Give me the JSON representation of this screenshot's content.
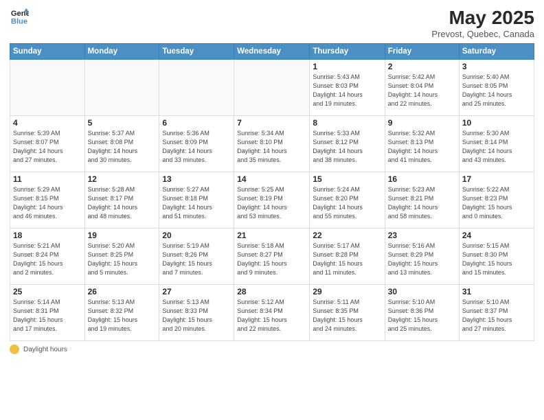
{
  "logo": {
    "line1": "General",
    "line2": "Blue"
  },
  "title": "May 2025",
  "subtitle": "Prevost, Quebec, Canada",
  "days_header": [
    "Sunday",
    "Monday",
    "Tuesday",
    "Wednesday",
    "Thursday",
    "Friday",
    "Saturday"
  ],
  "weeks": [
    [
      {
        "num": "",
        "info": ""
      },
      {
        "num": "",
        "info": ""
      },
      {
        "num": "",
        "info": ""
      },
      {
        "num": "",
        "info": ""
      },
      {
        "num": "1",
        "info": "Sunrise: 5:43 AM\nSunset: 8:03 PM\nDaylight: 14 hours\nand 19 minutes."
      },
      {
        "num": "2",
        "info": "Sunrise: 5:42 AM\nSunset: 8:04 PM\nDaylight: 14 hours\nand 22 minutes."
      },
      {
        "num": "3",
        "info": "Sunrise: 5:40 AM\nSunset: 8:05 PM\nDaylight: 14 hours\nand 25 minutes."
      }
    ],
    [
      {
        "num": "4",
        "info": "Sunrise: 5:39 AM\nSunset: 8:07 PM\nDaylight: 14 hours\nand 27 minutes."
      },
      {
        "num": "5",
        "info": "Sunrise: 5:37 AM\nSunset: 8:08 PM\nDaylight: 14 hours\nand 30 minutes."
      },
      {
        "num": "6",
        "info": "Sunrise: 5:36 AM\nSunset: 8:09 PM\nDaylight: 14 hours\nand 33 minutes."
      },
      {
        "num": "7",
        "info": "Sunrise: 5:34 AM\nSunset: 8:10 PM\nDaylight: 14 hours\nand 35 minutes."
      },
      {
        "num": "8",
        "info": "Sunrise: 5:33 AM\nSunset: 8:12 PM\nDaylight: 14 hours\nand 38 minutes."
      },
      {
        "num": "9",
        "info": "Sunrise: 5:32 AM\nSunset: 8:13 PM\nDaylight: 14 hours\nand 41 minutes."
      },
      {
        "num": "10",
        "info": "Sunrise: 5:30 AM\nSunset: 8:14 PM\nDaylight: 14 hours\nand 43 minutes."
      }
    ],
    [
      {
        "num": "11",
        "info": "Sunrise: 5:29 AM\nSunset: 8:15 PM\nDaylight: 14 hours\nand 46 minutes."
      },
      {
        "num": "12",
        "info": "Sunrise: 5:28 AM\nSunset: 8:17 PM\nDaylight: 14 hours\nand 48 minutes."
      },
      {
        "num": "13",
        "info": "Sunrise: 5:27 AM\nSunset: 8:18 PM\nDaylight: 14 hours\nand 51 minutes."
      },
      {
        "num": "14",
        "info": "Sunrise: 5:25 AM\nSunset: 8:19 PM\nDaylight: 14 hours\nand 53 minutes."
      },
      {
        "num": "15",
        "info": "Sunrise: 5:24 AM\nSunset: 8:20 PM\nDaylight: 14 hours\nand 55 minutes."
      },
      {
        "num": "16",
        "info": "Sunrise: 5:23 AM\nSunset: 8:21 PM\nDaylight: 14 hours\nand 58 minutes."
      },
      {
        "num": "17",
        "info": "Sunrise: 5:22 AM\nSunset: 8:23 PM\nDaylight: 15 hours\nand 0 minutes."
      }
    ],
    [
      {
        "num": "18",
        "info": "Sunrise: 5:21 AM\nSunset: 8:24 PM\nDaylight: 15 hours\nand 2 minutes."
      },
      {
        "num": "19",
        "info": "Sunrise: 5:20 AM\nSunset: 8:25 PM\nDaylight: 15 hours\nand 5 minutes."
      },
      {
        "num": "20",
        "info": "Sunrise: 5:19 AM\nSunset: 8:26 PM\nDaylight: 15 hours\nand 7 minutes."
      },
      {
        "num": "21",
        "info": "Sunrise: 5:18 AM\nSunset: 8:27 PM\nDaylight: 15 hours\nand 9 minutes."
      },
      {
        "num": "22",
        "info": "Sunrise: 5:17 AM\nSunset: 8:28 PM\nDaylight: 15 hours\nand 11 minutes."
      },
      {
        "num": "23",
        "info": "Sunrise: 5:16 AM\nSunset: 8:29 PM\nDaylight: 15 hours\nand 13 minutes."
      },
      {
        "num": "24",
        "info": "Sunrise: 5:15 AM\nSunset: 8:30 PM\nDaylight: 15 hours\nand 15 minutes."
      }
    ],
    [
      {
        "num": "25",
        "info": "Sunrise: 5:14 AM\nSunset: 8:31 PM\nDaylight: 15 hours\nand 17 minutes."
      },
      {
        "num": "26",
        "info": "Sunrise: 5:13 AM\nSunset: 8:32 PM\nDaylight: 15 hours\nand 19 minutes."
      },
      {
        "num": "27",
        "info": "Sunrise: 5:13 AM\nSunset: 8:33 PM\nDaylight: 15 hours\nand 20 minutes."
      },
      {
        "num": "28",
        "info": "Sunrise: 5:12 AM\nSunset: 8:34 PM\nDaylight: 15 hours\nand 22 minutes."
      },
      {
        "num": "29",
        "info": "Sunrise: 5:11 AM\nSunset: 8:35 PM\nDaylight: 15 hours\nand 24 minutes."
      },
      {
        "num": "30",
        "info": "Sunrise: 5:10 AM\nSunset: 8:36 PM\nDaylight: 15 hours\nand 25 minutes."
      },
      {
        "num": "31",
        "info": "Sunrise: 5:10 AM\nSunset: 8:37 PM\nDaylight: 15 hours\nand 27 minutes."
      }
    ]
  ],
  "footer": {
    "label": "Daylight hours"
  }
}
